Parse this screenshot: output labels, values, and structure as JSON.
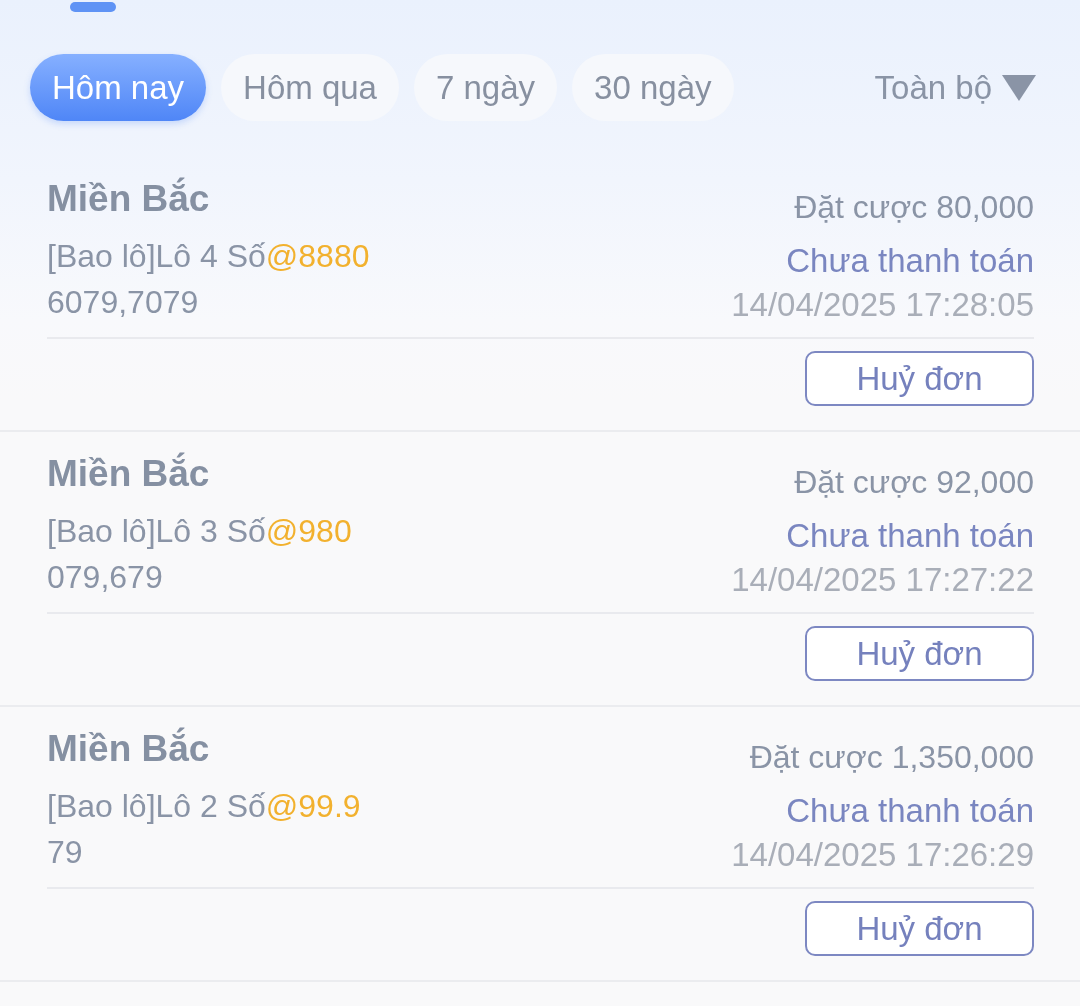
{
  "tabs": [
    {
      "label": "Hôm nay",
      "selected": true
    },
    {
      "label": "Hôm qua",
      "selected": false
    },
    {
      "label": "7 ngày",
      "selected": false
    },
    {
      "label": "30 ngày",
      "selected": false
    }
  ],
  "filter": {
    "label": "Toàn bộ"
  },
  "orders": [
    {
      "region": "Miền Bắc",
      "bet_type": "[Bao lô]Lô 4 Số",
      "odds": "@8880",
      "numbers": "6079,7079",
      "stake": "Đặt cược 80,000",
      "status": "Chưa thanh toán",
      "time": "14/04/2025 17:28:05",
      "action": "Huỷ đơn"
    },
    {
      "region": "Miền Bắc",
      "bet_type": "[Bao lô]Lô 3 Số",
      "odds": "@980",
      "numbers": "079,679",
      "stake": "Đặt cược 92,000",
      "status": "Chưa thanh toán",
      "time": "14/04/2025 17:27:22",
      "action": "Huỷ đơn"
    },
    {
      "region": "Miền Bắc",
      "bet_type": "[Bao lô]Lô 2 Số",
      "odds": "@99.9",
      "numbers": "79",
      "stake": "Đặt cược 1,350,000",
      "status": "Chưa thanh toán",
      "time": "14/04/2025 17:26:29",
      "action": "Huỷ đơn"
    }
  ]
}
